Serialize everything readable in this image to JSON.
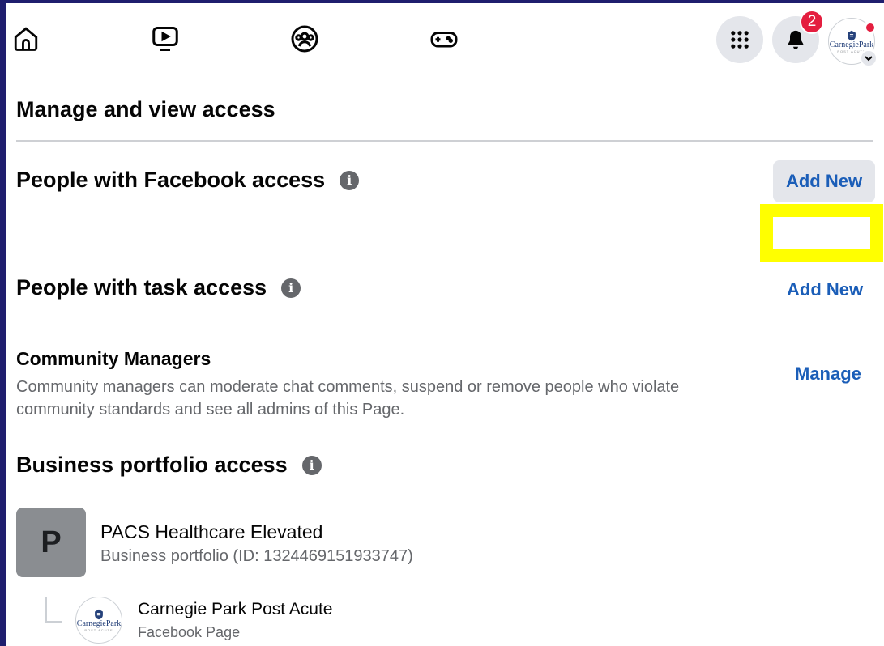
{
  "topbar": {
    "nav": [
      {
        "name": "home",
        "icon": "home-icon"
      },
      {
        "name": "video",
        "icon": "video-icon"
      },
      {
        "name": "groups",
        "icon": "groups-icon"
      },
      {
        "name": "gaming",
        "icon": "gamepad-icon"
      }
    ],
    "notifications_count": "2",
    "account_logo_text": "CarnegiePark",
    "account_logo_sub": "POST ACUTE"
  },
  "page": {
    "heading": "Manage and view access",
    "facebook_access": {
      "title": "People with Facebook access",
      "add_label": "Add New"
    },
    "task_access": {
      "title": "People with task access",
      "add_label": "Add New"
    },
    "community_managers": {
      "title": "Community Managers",
      "description": "Community managers can moderate chat comments, suspend or remove people who violate community standards and see all admins of this Page.",
      "manage_label": "Manage"
    },
    "business_portfolio": {
      "title": "Business portfolio access",
      "portfolio": {
        "initial": "P",
        "name": "PACS Healthcare Elevated",
        "subtitle": "Business portfolio (ID: 1324469151933747)"
      },
      "page": {
        "logo_text": "CarnegiePark",
        "logo_sub": "POST ACUTE",
        "name": "Carnegie Park Post Acute",
        "subtitle": "Facebook Page"
      }
    }
  },
  "colors": {
    "accent": "#1b5eb8",
    "highlight": "#ffff00",
    "badge": "#e41e3f"
  }
}
